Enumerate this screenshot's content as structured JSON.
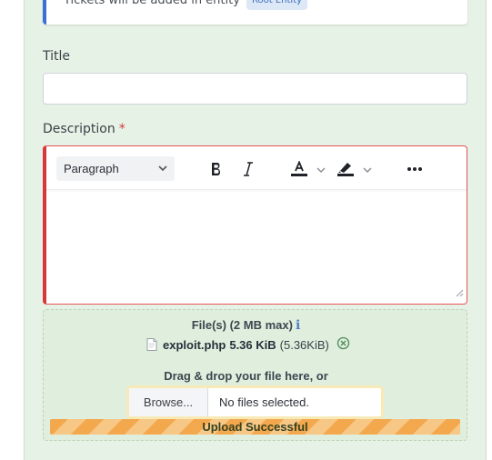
{
  "info": {
    "text": "Tickets will be added in entity",
    "entity_badge": "Root Entity"
  },
  "title_field": {
    "label": "Title",
    "value": ""
  },
  "description_field": {
    "label": "Description",
    "required_mark": "*"
  },
  "editor_toolbar": {
    "format_select": "Paragraph",
    "bold_icon": "bold-icon",
    "italic_icon": "italic-icon",
    "text_color_icon": "text-color-icon",
    "highlight_icon": "highlight-icon",
    "more_icon": "more-icon"
  },
  "attachments": {
    "title": "File(s) (2 MB max)",
    "info_icon": "ℹ",
    "file": {
      "name": "exploit.php",
      "size": "5.36 KiB",
      "size_exact": "(5.36KiB)"
    },
    "drag_text": "Drag & drop your file here, or",
    "browse_label": "Browse...",
    "no_files_text": "No files selected.",
    "progress_label": "Upload Successful",
    "progress_fraction": 1.0
  },
  "colors": {
    "panel_bg": "#e7f2e6",
    "error_border": "#d63939",
    "info_accent": "#3a6fd3",
    "progress_stripe_a": "#f3a84e",
    "progress_stripe_b": "#f7c786"
  }
}
